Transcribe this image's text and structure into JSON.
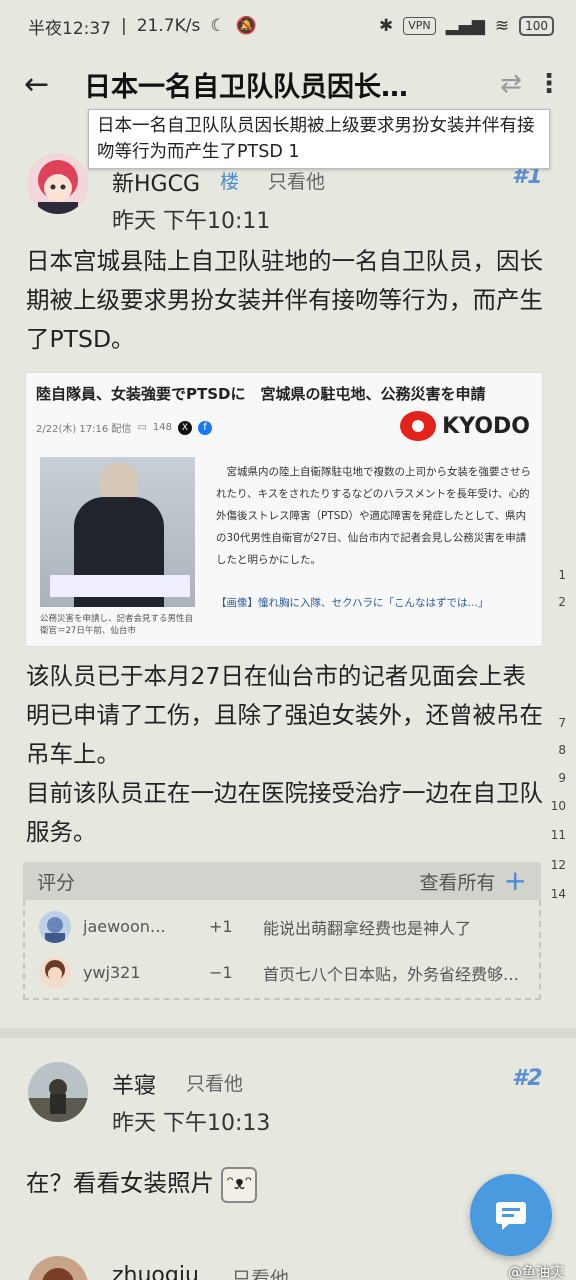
{
  "status_bar": {
    "time": "半夜12:37",
    "speed": "21.7K/s",
    "vpn": "VPN",
    "battery": "100"
  },
  "appbar": {
    "title": "日本一名自卫队队员因长…"
  },
  "tooltip": "日本一名自卫队队员因长期被上级要求男扮女装并伴有接吻等行为而产生了PTSD 1",
  "post1": {
    "username": "新HGCG",
    "floor_label": "楼",
    "only_him": "只看他",
    "floor": "#1",
    "time": "昨天 下午10:11",
    "text1": "日本宫城县陆上自卫队驻地的一名自卫队员，因长期被上级要求男扮女装并伴有接吻等行为，而产生了PTSD。",
    "text2": "该队员已于本月27日在仙台市的记者见面会上表明已申请了工伤，且除了强迫女装外，还曾被吊在吊车上。",
    "text3": "目前该队员正在一边在医院接受治疗一边在自卫队服务。",
    "news": {
      "headline": "陸自隊員、女装強要でPTSDに　宮城県の駐屯地、公務災害を申請",
      "date": "2/22(木) 17:16 配信",
      "comments": "148",
      "brand": "KYODO",
      "body": "　宮城県内の陸上自衛隊駐屯地で複数の上司から女装を強要させられたり、キスをされたりするなどのハラスメントを長年受け、心的外傷後ストレス障害（PTSD）や適応障害を発症したとして、県内の30代男性自衛官が27日、仙台市内で記者会見し公務災害を申請したと明らかにした。",
      "link": "【画像】憧れ胸に入隊、セクハラに「こんなはずでは…」",
      "caption": "公務災害を申請し、記者会見する男性自衛官＝27日午前、仙台市"
    }
  },
  "side_numbers": [
    "1",
    "2",
    "7",
    "8",
    "9",
    "10",
    "11",
    "12",
    "14"
  ],
  "rating": {
    "header": "评分",
    "view_all": "查看所有",
    "rows": [
      {
        "name": "jaewoon…",
        "score": "+1",
        "message": "能说出萌翻拿经费也是神人了"
      },
      {
        "name": "ywj321",
        "score": "−1",
        "message": "首页七八个日本贴，外务省经费够…"
      }
    ]
  },
  "post2": {
    "username": "羊寝",
    "only_him": "只看他",
    "floor": "#2",
    "time": "昨天 下午10:13",
    "text": "在？看看女装照片"
  },
  "post3": {
    "username": "zhuogiu",
    "only_him": "只看他"
  },
  "watermark": "@鱼油实",
  "colors": {
    "background": "#e6e7de",
    "accent": "#4a8ad4",
    "fab": "#4a9ae0",
    "kyodo_red": "#e2231a"
  }
}
